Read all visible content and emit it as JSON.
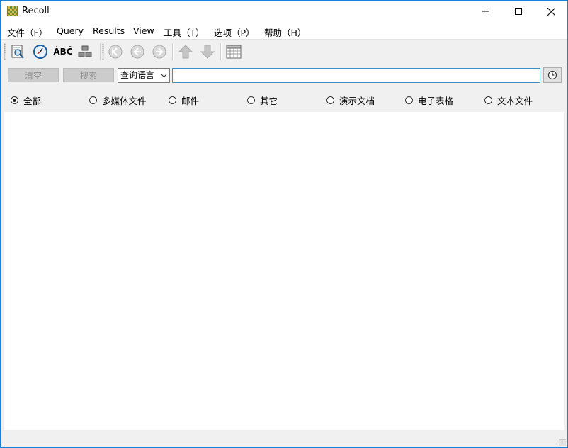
{
  "window": {
    "title": "Recoll"
  },
  "menu": [
    {
      "label": "文件（F）"
    },
    {
      "label": "Query"
    },
    {
      "label": "Results"
    },
    {
      "label": "View"
    },
    {
      "label": "工具（T）"
    },
    {
      "label": "选项（P）"
    },
    {
      "label": "帮助（H）"
    }
  ],
  "toolbar": {
    "buttons": [
      {
        "icon": "document-search-icon",
        "enabled": true
      },
      {
        "icon": "history-clock-icon",
        "enabled": true
      },
      {
        "icon": "spelling-icon",
        "label": "ÂBĈ",
        "enabled": true
      },
      {
        "icon": "index-blocks-icon",
        "enabled": true
      },
      {
        "icon": "first-page-icon",
        "enabled": false
      },
      {
        "icon": "previous-page-icon",
        "enabled": false
      },
      {
        "icon": "next-page-icon",
        "enabled": false
      },
      {
        "icon": "sort-up-icon",
        "enabled": false
      },
      {
        "icon": "sort-down-icon",
        "enabled": false
      },
      {
        "icon": "table-view-icon",
        "enabled": true
      }
    ]
  },
  "search": {
    "clear_label": "清空",
    "search_label": "搜索",
    "mode_selected": "查询语言",
    "query_value": "",
    "history_icon": "clock-icon"
  },
  "filters": {
    "options": [
      {
        "label": "全部",
        "checked": true
      },
      {
        "label": "多媒体文件",
        "checked": false
      },
      {
        "label": "邮件",
        "checked": false
      },
      {
        "label": "其它",
        "checked": false
      },
      {
        "label": "演示文档",
        "checked": false
      },
      {
        "label": "电子表格",
        "checked": false
      },
      {
        "label": "文本文件",
        "checked": false
      }
    ]
  },
  "colors": {
    "window_border": "#1883d7",
    "input_focus_border": "#3c8fc9",
    "disabled_button_bg": "#cccccc"
  }
}
